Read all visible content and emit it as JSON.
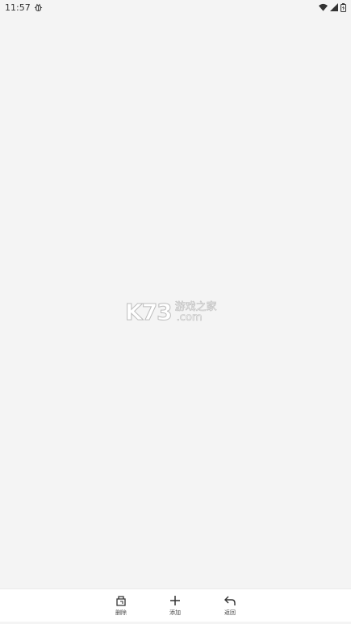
{
  "status_bar": {
    "time": "11:57",
    "notification_icon": "bug-icon",
    "wifi_icon": "wifi-icon",
    "signal_icon": "cell-signal-icon",
    "battery_icon": "battery-icon"
  },
  "watermark": {
    "logo": "K73",
    "cn_text": "游戏之家",
    "domain": ".com"
  },
  "toolbar": {
    "delete_label": "删除",
    "add_label": "添加",
    "back_label": "返回"
  }
}
